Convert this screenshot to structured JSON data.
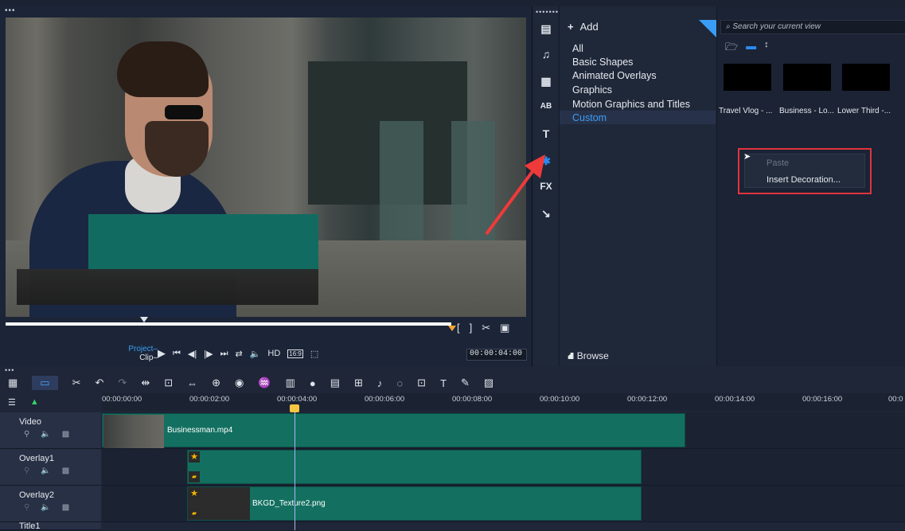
{
  "preview": {
    "project_label": "Project",
    "clip_label": "Clip",
    "hd_label": "HD",
    "aspect_label": "16:9",
    "timecode": "00:00:04:00"
  },
  "sidebar": {
    "icons": [
      "media-icon",
      "audio-icon",
      "instant-project-icon",
      "transition-icon",
      "title-icon",
      "graphic-icon",
      "fx-icon",
      "path-icon"
    ],
    "fx_label": "FX",
    "title_label": "T"
  },
  "library": {
    "add_label": "Add",
    "categories": [
      "All",
      "Basic Shapes",
      "Animated Overlays",
      "Graphics",
      "Motion Graphics and Titles",
      "Custom"
    ],
    "selected_category": "Custom",
    "browse_label": "Browse"
  },
  "gallery": {
    "search_placeholder": "Search your current view",
    "thumbnails": [
      "Travel Vlog - ...",
      "Business - Lo...",
      "Lower Third -..."
    ],
    "context_menu": {
      "paste": "Paste",
      "insert": "Insert Decoration..."
    }
  },
  "timeline": {
    "ruler_ticks": [
      "00:00:00:00",
      "00:00:02:00",
      "00:00:04:00",
      "00:00:06:00",
      "00:00:08:00",
      "00:00:10:00",
      "00:00:12:00",
      "00:00:14:00",
      "00:00:16:00",
      "00:0"
    ],
    "tracks": [
      {
        "name": "Video",
        "clip": "Businessman.mp4"
      },
      {
        "name": "Overlay1",
        "clip": ""
      },
      {
        "name": "Overlay2",
        "clip": "BKGD_Texture2.png"
      },
      {
        "name": "Title1",
        "clip": ""
      }
    ],
    "title_3d_label": "T",
    "colors": {
      "clip": "#137060",
      "accent": "#2a8bf2",
      "highlight_box": "#e0343c",
      "arrow": "#ef3a3a"
    }
  }
}
